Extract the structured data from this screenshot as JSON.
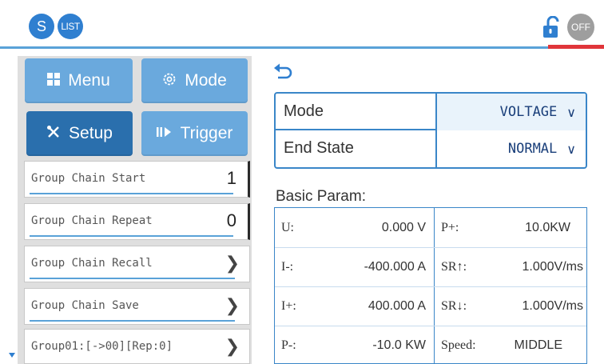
{
  "topbar": {
    "s_badge": "S",
    "list_badge": "LIST",
    "off_badge": "OFF",
    "accent_color": "#2f7fd0",
    "lock_icon": "unlocked-padlock-icon"
  },
  "nav": {
    "menu_label": "Menu",
    "mode_label": "Mode",
    "setup_label": "Setup",
    "trigger_label": "Trigger"
  },
  "group_list": [
    {
      "label": "Group Chain Start",
      "value": "1"
    },
    {
      "label": "Group Chain Repeat",
      "value": "0"
    },
    {
      "label": "Group Chain Recall",
      "value": ""
    },
    {
      "label": "Group Chain Save",
      "value": ""
    },
    {
      "label": "Group01:[->00][Rep:0]",
      "value": ""
    }
  ],
  "mode_box": {
    "mode_label": "Mode",
    "mode_value": "VOLTAGE",
    "end_state_label": "End State",
    "end_state_value": "NORMAL"
  },
  "basic_param": {
    "title": "Basic Param:",
    "left": [
      {
        "key": "U:",
        "value": "0.000 V"
      },
      {
        "key": "I-:",
        "value": "-400.000 A"
      },
      {
        "key": "I+:",
        "value": "400.000 A"
      },
      {
        "key": "P-:",
        "value": "-10.0 KW"
      }
    ],
    "right": [
      {
        "key": "P+:",
        "value": "10.0KW"
      },
      {
        "key": "SR↑:",
        "value": "1.000V/ms"
      },
      {
        "key": "SR↓:",
        "value": "1.000V/ms"
      },
      {
        "key": "Speed:",
        "value": "MIDDLE"
      }
    ]
  }
}
